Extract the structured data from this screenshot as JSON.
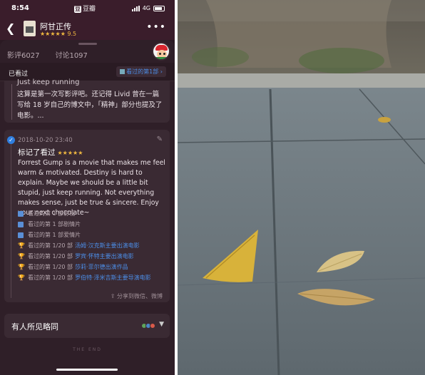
{
  "status_bar": {
    "time": "8:54",
    "app_label": "豆瓣",
    "network": "4G"
  },
  "header": {
    "movie_title": "阿甘正传",
    "stars": "★★★★★",
    "score": "9.5"
  },
  "tabs": [
    {
      "label": "影评6027"
    },
    {
      "label": "讨论1097"
    }
  ],
  "seen_bar": {
    "label": "已看过",
    "pill": "看过的第1部"
  },
  "prev_review": {
    "cut_text": "Just keep running",
    "body": "这算是第一次写影评吧。还记得 Livid 曾在一篇写给 18 岁自己的博文中，「精神」部分也提及了电影。..."
  },
  "review": {
    "date": "2018-10-20 23:40",
    "mark_label": "标记了看过",
    "stars": "★★★★★",
    "text": "Forrest Gump is a movie that makes me feel warm & motivated. Destiny is hard to explain. Maybe we should be a little bit stupid, just keep running. Not everything makes sense, just be true & sincere. Enjoy your next chocolate~",
    "badges": [
      {
        "text": "看过的第 1 部影视",
        "link": ""
      },
      {
        "text": "看过的第 1 部剧情片",
        "link": ""
      },
      {
        "text": "看过的第 1 部爱情片",
        "link": ""
      },
      {
        "text": "看过的第 1/20 部",
        "link": "汤姆·汉克斯主要出演电影"
      },
      {
        "text": "看过的第 1/20 部",
        "link": "罗宾·怀特主要出演电影"
      },
      {
        "text": "看过的第 1/20 部",
        "link": "莎莉·菲尔德出演作品"
      },
      {
        "text": "看过的第 1/20 部",
        "link": "罗伯特·泽米吉斯主要导演电影"
      }
    ],
    "share": "分享到微信、微博"
  },
  "opinion": {
    "title": "有人所见略同"
  },
  "footer": {
    "the_end": "THE END"
  },
  "colors": {
    "bg": "#2f1f28",
    "accent_blue": "#4c8ee8",
    "star": "#f0b840"
  }
}
